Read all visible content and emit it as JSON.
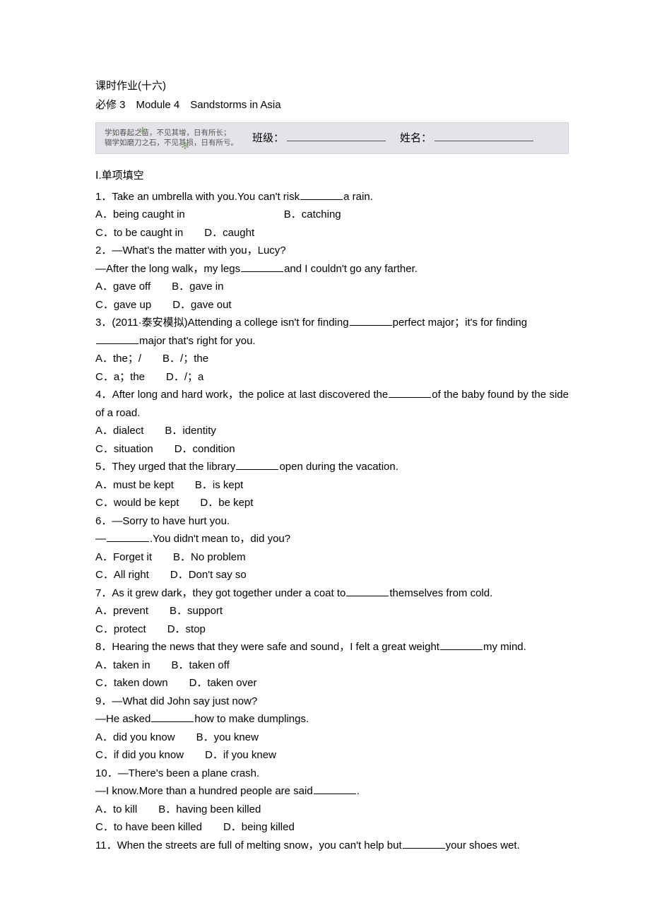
{
  "heading": "课时作业(十六)",
  "subtitle": "必修 3　Module 4　Sandstorms in Asia",
  "banner": {
    "motto1": "学如春起之苗，不见其增，日有所长；",
    "motto2": "辍学如磨刀之石，不见其损，日有所亏。",
    "class_label": "班级：",
    "name_label": "姓名："
  },
  "section_label": "Ⅰ.单项填空",
  "questions": [
    {
      "num": "1",
      "stem_pre": "．Take an umbrella with you.You can't risk",
      "stem_post": "a rain.",
      "rows": [
        [
          {
            "l": "A",
            "t": "．being caught in",
            "wide": true
          },
          {
            "l": "B",
            "t": "．catching"
          }
        ],
        [
          {
            "l": "C",
            "t": "．to be caught in",
            "wide": false,
            "gap": true
          },
          {
            "l": "D",
            "t": "．caught"
          }
        ]
      ]
    },
    {
      "num": "2",
      "stem_pre": "．—What's the matter with you，Lucy?",
      "second_pre": "—After the long walk，my legs",
      "second_post": "and I couldn't go any farther.",
      "rows": [
        [
          {
            "l": "A",
            "t": "．gave off",
            "gap": true
          },
          {
            "l": "B",
            "t": "．gave in"
          }
        ],
        [
          {
            "l": "C",
            "t": "．gave up",
            "gap": true
          },
          {
            "l": "D",
            "t": "．gave out"
          }
        ]
      ]
    },
    {
      "num": "3",
      "stem_pre": "．(2011·泰安模拟)Attending a college isn't for finding",
      "stem_post": "perfect major；it's for finding",
      "second_post": "major that's right for you.",
      "second_has_blank_prefix": true,
      "rows": [
        [
          {
            "l": "A",
            "t": "．the；/",
            "gap": true
          },
          {
            "l": "B",
            "t": "．/；the"
          }
        ],
        [
          {
            "l": "C",
            "t": "．a；the",
            "gap": true
          },
          {
            "l": "D",
            "t": "．/；a"
          }
        ]
      ]
    },
    {
      "num": "4",
      "stem_pre": "．After long and hard work，the police at last discovered the",
      "stem_post": "of the baby found by the side of a road.",
      "rows": [
        [
          {
            "l": "A",
            "t": "．dialect",
            "gap": true
          },
          {
            "l": "B",
            "t": "．identity"
          }
        ],
        [
          {
            "l": "C",
            "t": "．situation",
            "gap": true
          },
          {
            "l": "D",
            "t": "．condition"
          }
        ]
      ]
    },
    {
      "num": "5",
      "stem_pre": "．They urged that the library",
      "stem_post": "open during the vacation.",
      "rows": [
        [
          {
            "l": "A",
            "t": "．must be kept",
            "gap": true
          },
          {
            "l": "B",
            "t": "．is kept"
          }
        ],
        [
          {
            "l": "C",
            "t": "．would be kept",
            "gap": true
          },
          {
            "l": "D",
            "t": "．be kept"
          }
        ]
      ]
    },
    {
      "num": "6",
      "stem_pre": "．—Sorry to have hurt you.",
      "second_pre": "—",
      "second_post": ".You didn't mean to，did you?",
      "rows": [
        [
          {
            "l": "A",
            "t": "．Forget it",
            "gap": true
          },
          {
            "l": "B",
            "t": "．No problem"
          }
        ],
        [
          {
            "l": "C",
            "t": "．All right",
            "gap": true
          },
          {
            "l": "D",
            "t": "．Don't say so"
          }
        ]
      ]
    },
    {
      "num": "7",
      "stem_pre": "．As it grew dark，they got together under a coat to",
      "stem_post": "themselves from cold.",
      "rows": [
        [
          {
            "l": "A",
            "t": "．prevent",
            "gap": true
          },
          {
            "l": "B",
            "t": "．support"
          }
        ],
        [
          {
            "l": "C",
            "t": "．protect",
            "gap": true
          },
          {
            "l": "D",
            "t": "．stop"
          }
        ]
      ]
    },
    {
      "num": "8",
      "stem_pre": "．Hearing the news that they were safe and sound，I felt a great weight",
      "stem_post": "my mind.",
      "stem_justify": true,
      "rows": [
        [
          {
            "l": "A",
            "t": "．taken in",
            "gap": true
          },
          {
            "l": "B",
            "t": "．taken off"
          }
        ],
        [
          {
            "l": "C",
            "t": "．taken down",
            "gap": true
          },
          {
            "l": "D",
            "t": "．taken over"
          }
        ]
      ]
    },
    {
      "num": "9",
      "stem_pre": "．—What did John say just now?",
      "second_pre": "—He asked",
      "second_post": "how to make dumplings.",
      "rows": [
        [
          {
            "l": "A",
            "t": "．did you know",
            "gap": true
          },
          {
            "l": "B",
            "t": "．you knew"
          }
        ],
        [
          {
            "l": "C",
            "t": "．if did you know",
            "gap": true
          },
          {
            "l": "D",
            "t": "．if you knew"
          }
        ]
      ]
    },
    {
      "num": "10",
      "stem_pre": "．—There's been a plane crash.",
      "second_pre": "—I know.More than a hundred people are said",
      "second_post": ".",
      "rows": [
        [
          {
            "l": "A",
            "t": "．to kill",
            "gap": true
          },
          {
            "l": "B",
            "t": "．having been killed"
          }
        ],
        [
          {
            "l": "C",
            "t": "．to have been killed",
            "gap": true
          },
          {
            "l": "D",
            "t": "．being killed"
          }
        ]
      ]
    },
    {
      "num": "11",
      "stem_pre": "．When the streets are full of melting snow，you can't help but",
      "stem_post": "your shoes wet."
    }
  ]
}
